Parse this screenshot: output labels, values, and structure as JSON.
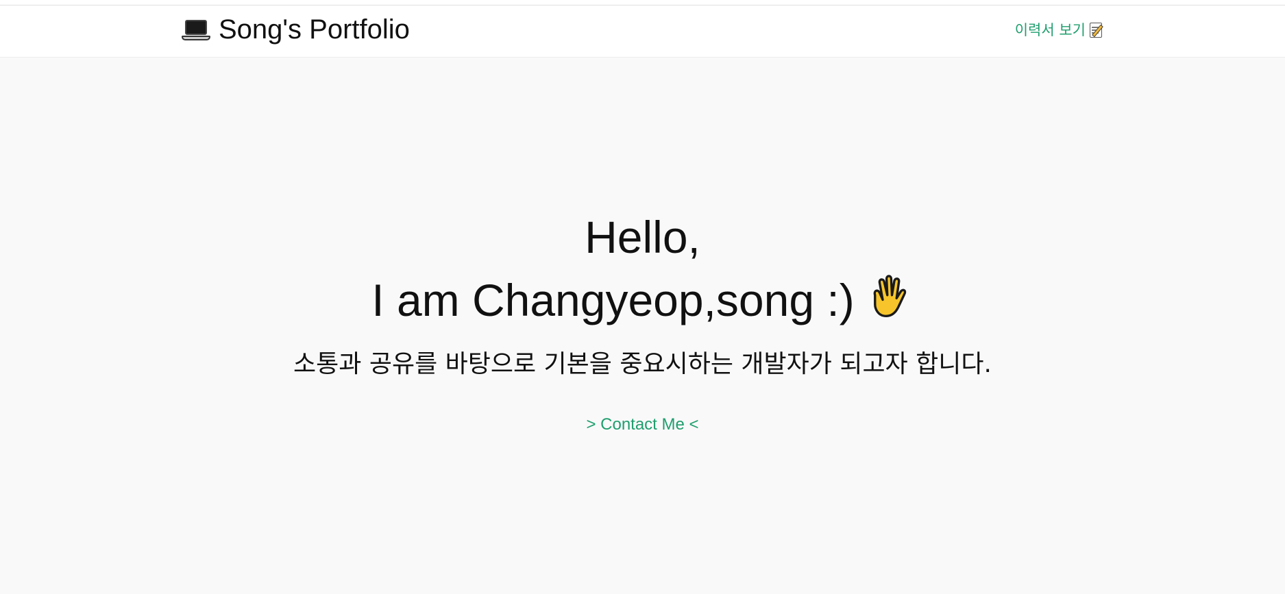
{
  "navbar": {
    "brand_icon": "laptop-icon",
    "brand_label": "Song's Portfolio",
    "resume_label": "이력서 보기",
    "resume_icon": "memo-icon",
    "link_color": "#1f9e6e"
  },
  "hero": {
    "greeting": "Hello,",
    "intro": "I am Changyeop,song :)",
    "intro_icon": "raised-hand-icon",
    "tagline": "소통과 공유를 바탕으로 기본을 중요시하는 개발자가 되고자 합니다.",
    "contact_label": "> Contact Me <"
  }
}
